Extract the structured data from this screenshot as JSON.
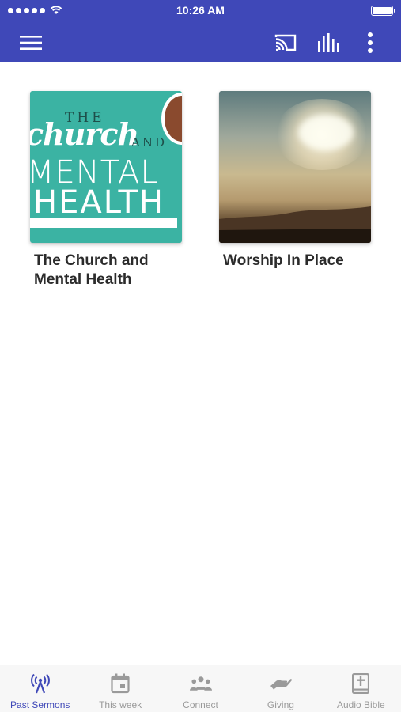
{
  "status_bar": {
    "time": "10:26 AM",
    "icons": [
      "signal-dots-icon",
      "wifi-icon",
      "battery-icon"
    ]
  },
  "app_bar": {
    "icons": [
      "menu-icon",
      "cast-icon",
      "equalizer-icon",
      "more-vert-icon"
    ],
    "background": "#3f48b8"
  },
  "sermons": [
    {
      "title": "The Church and Mental Health",
      "artwork": {
        "the": "THE",
        "church": "church",
        "and": "AND",
        "mental": "MENTAL",
        "health": "HEALTH"
      }
    },
    {
      "title": "Worship In Place"
    }
  ],
  "tabs": [
    {
      "label": "Past Sermons",
      "icon": "broadcast-icon",
      "active": true
    },
    {
      "label": "This week",
      "icon": "calendar-icon",
      "active": false
    },
    {
      "label": "Connect",
      "icon": "people-icon",
      "active": false
    },
    {
      "label": "Giving",
      "icon": "giving-hand-icon",
      "active": false
    },
    {
      "label": "Audio Bible",
      "icon": "bible-icon",
      "active": false
    }
  ],
  "colors": {
    "accent": "#3f48b8",
    "tab_inactive": "#9a9a9a",
    "art_teal": "#3bb3a3"
  }
}
